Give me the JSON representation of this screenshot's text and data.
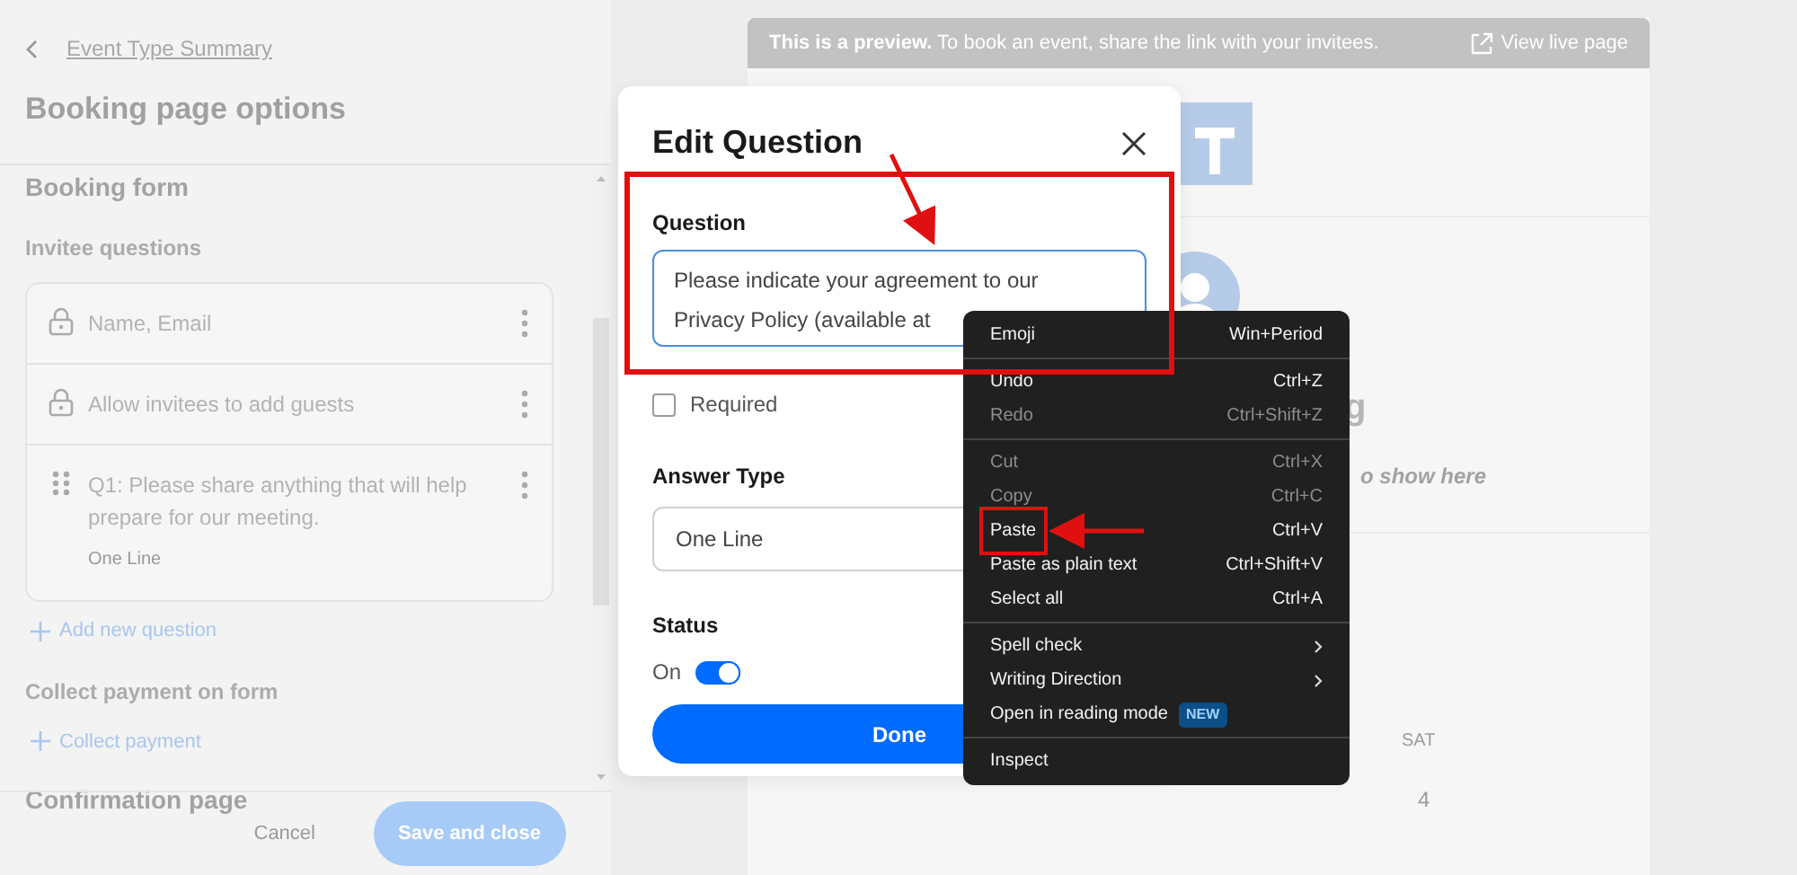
{
  "sidebar": {
    "back_link": "Event Type Summary",
    "title": "Booking page options",
    "section_title": "Booking form",
    "subsection_title": "Invitee questions",
    "questions": [
      {
        "kind": "locked",
        "text": "Name, Email"
      },
      {
        "kind": "locked",
        "text": "Allow invitees to add guests"
      },
      {
        "kind": "draggable",
        "text": "Q1: Please share anything that will help prepare for our meeting.",
        "answer_type": "One Line"
      }
    ],
    "add_question": "Add new question",
    "payment_title": "Collect payment on form",
    "collect_payment": "Collect payment",
    "confirmation_title": "Confirmation page",
    "cancel": "Cancel",
    "save": "Save and close"
  },
  "preview": {
    "banner": "**This is a preview.** To book an event, share the link with your invitees.",
    "view_live": "View live page",
    "heading_fragment": "g",
    "description_fragment": "o show here",
    "weekday": "SAT",
    "day": "4"
  },
  "dialog": {
    "title": "Edit Question",
    "question_label": "Question",
    "question_value": "Please indicate your agreement to our Privacy Policy (available at",
    "required": {
      "label": "Required",
      "checked": false
    },
    "answer_type_label": "Answer Type",
    "answer_type_value": "One Line",
    "status_label": "Status",
    "status": {
      "label": "On",
      "on": true
    },
    "done": "Done"
  },
  "context_menu": {
    "items": [
      {
        "kind": "command",
        "label": "Emoji",
        "shortcut": "Win+Period",
        "disabled": false
      },
      {
        "kind": "separator"
      },
      {
        "kind": "command",
        "label": "Undo",
        "shortcut": "Ctrl+Z",
        "disabled": false
      },
      {
        "kind": "command",
        "label": "Redo",
        "shortcut": "Ctrl+Shift+Z",
        "disabled": true
      },
      {
        "kind": "separator"
      },
      {
        "kind": "command",
        "label": "Cut",
        "shortcut": "Ctrl+X",
        "disabled": true
      },
      {
        "kind": "command",
        "label": "Copy",
        "shortcut": "Ctrl+C",
        "disabled": true
      },
      {
        "kind": "command",
        "label": "Paste",
        "shortcut": "Ctrl+V",
        "disabled": false,
        "highlighted": true
      },
      {
        "kind": "command",
        "label": "Paste as plain text",
        "shortcut": "Ctrl+Shift+V",
        "disabled": false
      },
      {
        "kind": "command",
        "label": "Select all",
        "shortcut": "Ctrl+A",
        "disabled": false
      },
      {
        "kind": "separator"
      },
      {
        "kind": "submenu",
        "label": "Spell check",
        "disabled": false
      },
      {
        "kind": "submenu",
        "label": "Writing Direction",
        "disabled": false
      },
      {
        "kind": "command",
        "label": "Open in reading mode",
        "badge": "NEW",
        "disabled": false
      },
      {
        "kind": "separator"
      },
      {
        "kind": "command",
        "label": "Inspect",
        "disabled": false
      }
    ]
  }
}
